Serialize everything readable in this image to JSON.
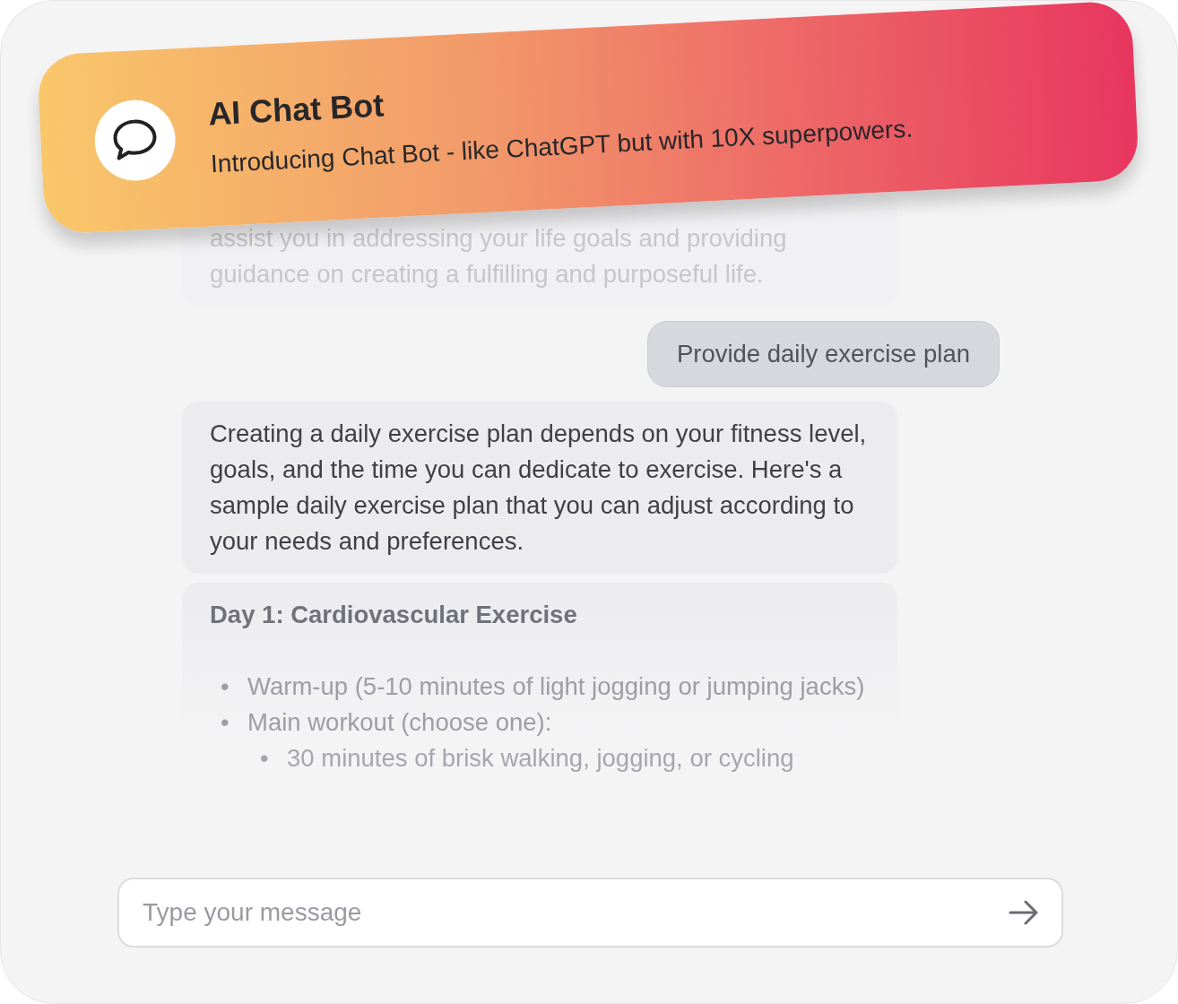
{
  "banner": {
    "title": "AI Chat Bot",
    "subtitle": "Introducing Chat Bot - like ChatGPT but with 10X superpowers."
  },
  "messages": [
    {
      "kind": "faded",
      "lines": [
        "assist you in addressing your life goals and providing",
        "guidance on creating a fulfilling and purposeful life."
      ]
    },
    {
      "kind": "user",
      "text": "Provide daily exercise plan"
    },
    {
      "kind": "bot",
      "text": "Creating a daily exercise plan depends on your fitness level, goals, and the time you can dedicate to exercise. Here's a sample daily exercise plan that you can adjust according to your needs and preferences."
    },
    {
      "kind": "plan",
      "heading": "Day 1: Cardiovascular Exercise",
      "items": [
        {
          "marker": "•",
          "text": "Warm-up (5-10 minutes of light jogging or jumping jacks)"
        },
        {
          "marker": "•",
          "text": "Main workout (choose one):",
          "children": [
            {
              "marker": "•",
              "text": "30 minutes of brisk walking, jogging, or cycling"
            }
          ]
        }
      ]
    }
  ],
  "composer": {
    "placeholder": "Type your message"
  }
}
